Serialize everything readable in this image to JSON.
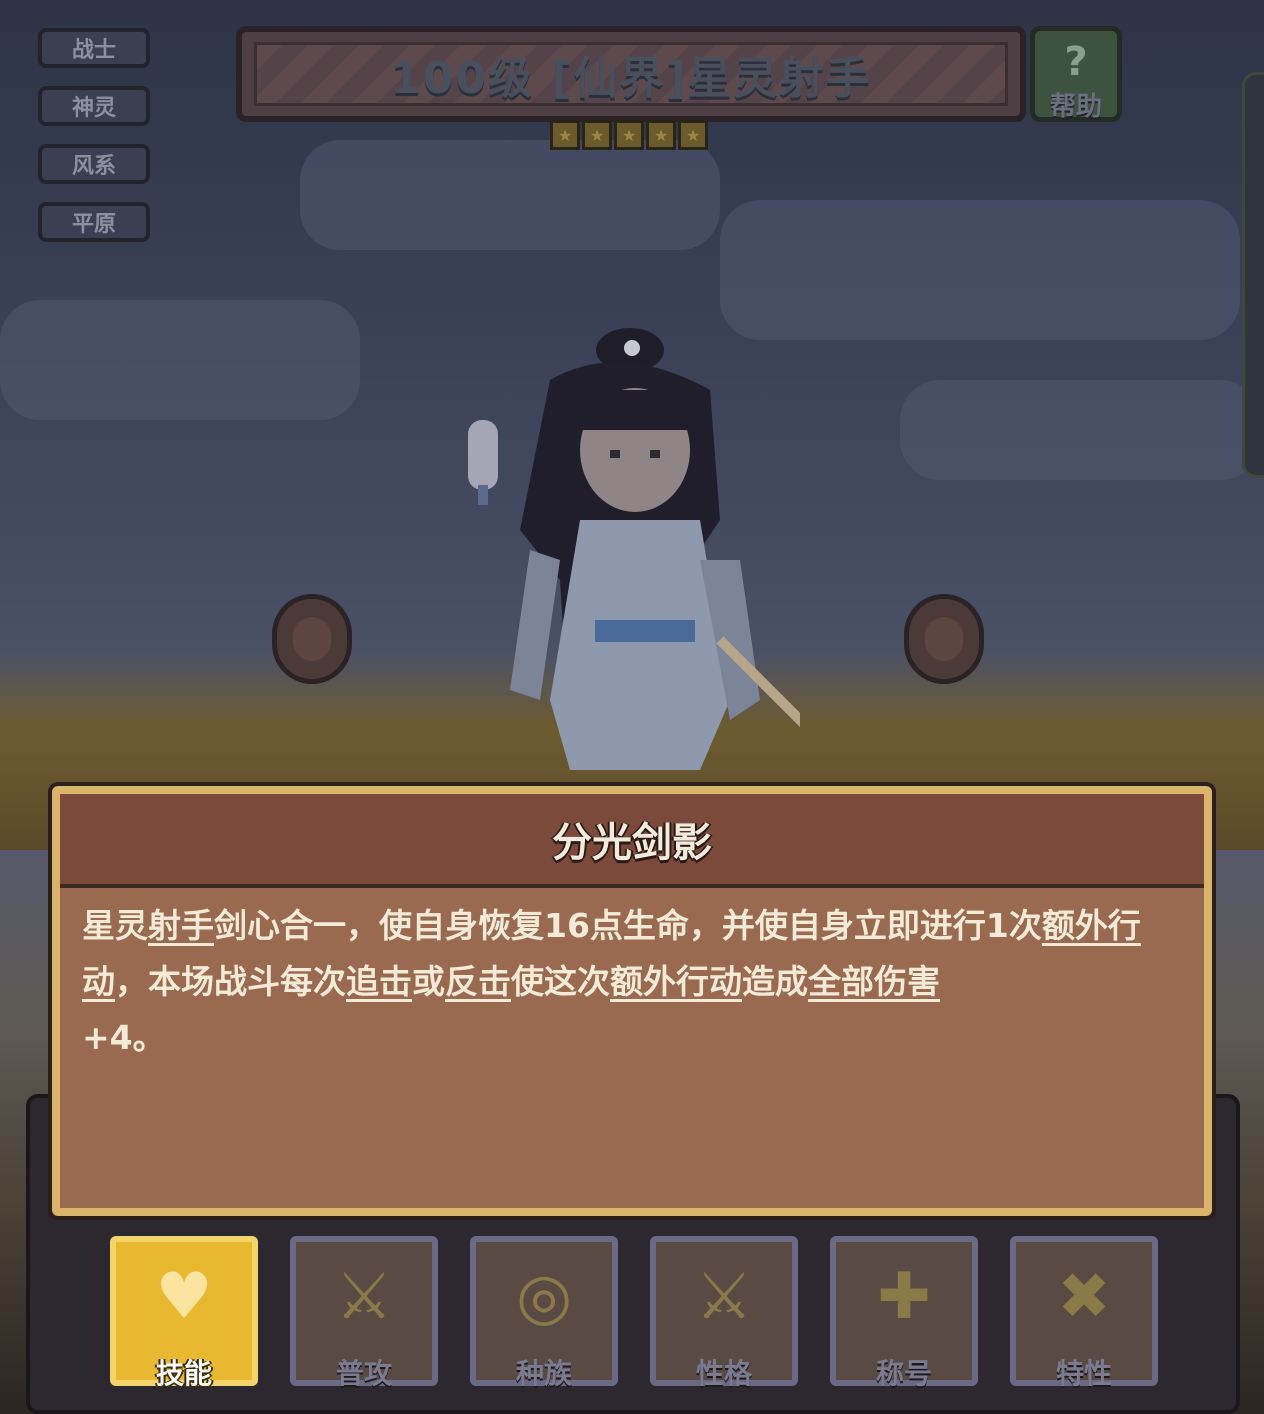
{
  "tags": [
    "战士",
    "神灵",
    "风系",
    "平原"
  ],
  "title": "100级 [仙界]星灵射手",
  "stars": 5,
  "help": {
    "icon": "?",
    "label": "帮助"
  },
  "dialog": {
    "title": "分光剑影",
    "desc_parts": [
      {
        "t": "星灵",
        "u": false
      },
      {
        "t": "射手",
        "u": true
      },
      {
        "t": "剑心合一，使自身恢复16点生命，并使自身立即进行1次",
        "u": false
      },
      {
        "t": "额外行动",
        "u": true
      },
      {
        "t": "，本场战斗每次",
        "u": false
      },
      {
        "t": "追击",
        "u": true
      },
      {
        "t": "或",
        "u": false
      },
      {
        "t": "反击",
        "u": true
      },
      {
        "t": "使这次",
        "u": false
      },
      {
        "t": "额外行动",
        "u": true
      },
      {
        "t": "造成",
        "u": false
      },
      {
        "t": "全部伤害",
        "u": true
      },
      {
        "t": "+4。",
        "u": false
      }
    ]
  },
  "tabs": [
    {
      "label": "技能",
      "icon": "heart-icon",
      "active": true
    },
    {
      "label": "普攻",
      "icon": "sword-icon",
      "active": false
    },
    {
      "label": "种族",
      "icon": "race-icon",
      "active": false
    },
    {
      "label": "性格",
      "icon": "sword-icon",
      "active": false
    },
    {
      "label": "称号",
      "icon": "cross-icon",
      "active": false
    },
    {
      "label": "特性",
      "icon": "crossed-swords-icon",
      "active": false
    }
  ],
  "colors": {
    "active_tab": "#e8b830",
    "dialog_border": "#d9b46a",
    "dialog_head": "#7b4a3a",
    "dialog_body": "#9a6a50"
  }
}
